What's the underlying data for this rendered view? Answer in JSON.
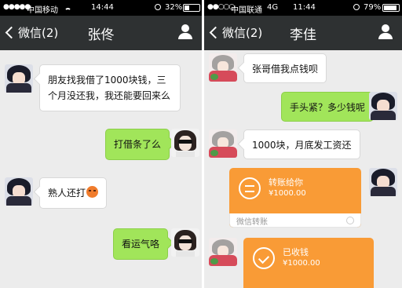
{
  "left": {
    "status": {
      "carrier": "中国移动",
      "time": "14:44",
      "battery": "32%",
      "battery_level": 0.32
    },
    "back_label": "微信(2)",
    "title": "张佟",
    "messages": [
      {
        "side": "in",
        "text": "朋友找我借了1000块钱，三个月没还我，我还能要回来么"
      },
      {
        "side": "out",
        "text": "打借条了么"
      },
      {
        "side": "in",
        "text": "熟人还打"
      },
      {
        "side": "out",
        "text": "看运气咯"
      }
    ]
  },
  "right": {
    "status": {
      "carrier": "中国联通",
      "network": "4G",
      "time": "11:44",
      "battery": "79%",
      "battery_level": 0.79
    },
    "back_label": "微信(2)",
    "title": "李佳",
    "messages": [
      {
        "side": "in",
        "text": "张哥借我点钱呗"
      },
      {
        "side": "out",
        "text": "手头紧？多少钱呢"
      },
      {
        "side": "in",
        "text": "1000块，月底发工资还"
      }
    ],
    "transfer_sent": {
      "label": "转账给你",
      "amount": "¥1000.00",
      "footer": "微信转账"
    },
    "transfer_received": {
      "label": "已收钱",
      "amount": "¥1000.00"
    }
  },
  "colors": {
    "titlebar": "#2e3132",
    "chat_bg": "#ececec",
    "out_bubble": "#a1e55a",
    "transfer": "#f99b36"
  }
}
